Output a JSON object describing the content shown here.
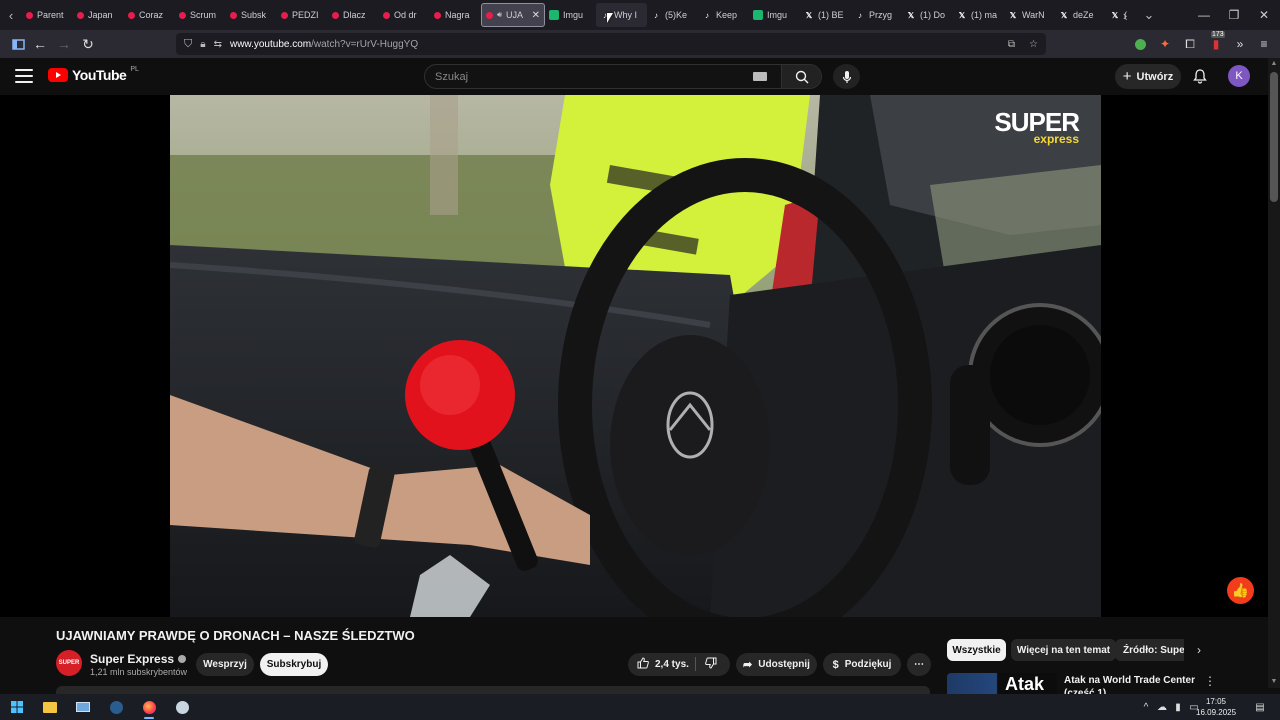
{
  "browser": {
    "tabs": [
      {
        "label": "Parent",
        "favicon": "youtube"
      },
      {
        "label": "Japan",
        "favicon": "youtube"
      },
      {
        "label": "Coraz",
        "favicon": "youtube"
      },
      {
        "label": "Scrum",
        "favicon": "youtube"
      },
      {
        "label": "Subsk",
        "favicon": "youtube"
      },
      {
        "label": "PEDZI",
        "favicon": "youtube"
      },
      {
        "label": "Dlacz",
        "favicon": "youtube"
      },
      {
        "label": "Od dr",
        "favicon": "youtube"
      },
      {
        "label": "Nagra",
        "favicon": "youtube"
      },
      {
        "label": "UJA",
        "favicon": "youtube",
        "active": true,
        "audio": true
      },
      {
        "label": "Imgu",
        "favicon": "imgur"
      },
      {
        "label": "Why I",
        "favicon": "tiktok",
        "hover": true
      },
      {
        "label": "(5)Ke",
        "favicon": "tiktok"
      },
      {
        "label": "Keep",
        "favicon": "tiktok"
      },
      {
        "label": "Imgu",
        "favicon": "imgur"
      },
      {
        "label": "(1) BE",
        "favicon": "x"
      },
      {
        "label": "Przyg",
        "favicon": "tiktok"
      },
      {
        "label": "(1) Do",
        "favicon": "x"
      },
      {
        "label": "(1) ma",
        "favicon": "x"
      },
      {
        "label": "WarN",
        "favicon": "x"
      },
      {
        "label": "deZe",
        "favicon": "x"
      },
      {
        "label": "(",
        "favicon": "x"
      }
    ],
    "url_domain": "www.youtube.com",
    "url_path": "/watch?v=rUrV-HuggYQ",
    "extension_badge": "173"
  },
  "youtube": {
    "logo_text": "YouTube",
    "country_code": "PL",
    "search_placeholder": "Szukaj",
    "create_label": "Utwórz",
    "avatar_letter": "K"
  },
  "video": {
    "overlay_brand_top": "SUPER",
    "overlay_brand_bottom": "express",
    "title": "UJAWNIAMY PRAWDĘ O DRONACH – NASZE ŚLEDZTWO"
  },
  "channel": {
    "name": "Super Express",
    "subscribers": "1,21 mln subskrybentów",
    "avatar_text": "SUPER"
  },
  "actions": {
    "support": "Wesprzyj",
    "subscribe": "Subskrybuj",
    "likes": "2,4 tys.",
    "share": "Udostępnij",
    "thanks": "Podziękuj"
  },
  "chips": [
    "Wszystkie",
    "Więcej na ten temat",
    "Źródło: Super"
  ],
  "recommended": {
    "thumb_text": "Atak",
    "title": "Atak na World Trade Center (część 1)"
  },
  "taskbar": {
    "time": "17:05",
    "date": "16.09.2025"
  },
  "colors": {
    "youtube_red": "#ff0000",
    "accent_orange": "#f23c1c",
    "avatar_purple": "#7e57c2"
  }
}
